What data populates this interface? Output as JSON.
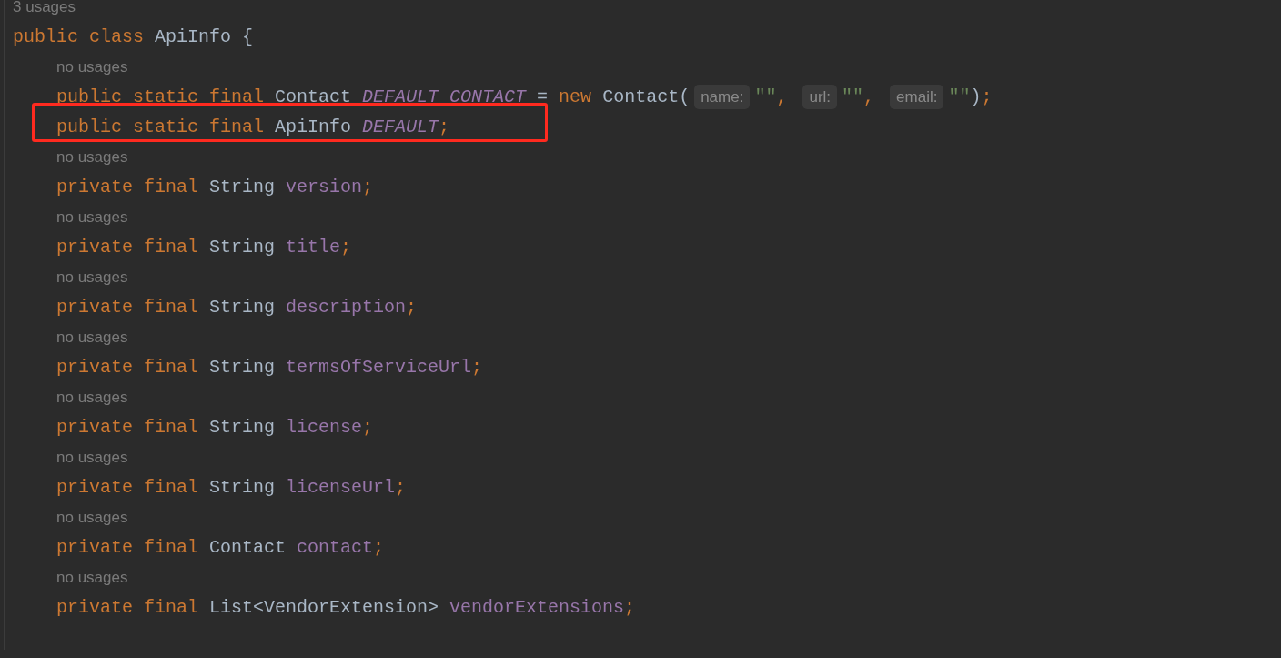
{
  "editor": {
    "lines": [
      {
        "kind": "usage",
        "text": "3 usages"
      },
      {
        "kind": "code",
        "tokens": [
          {
            "kind": "keyword",
            "text": "public class "
          },
          {
            "kind": "plain",
            "text": "ApiInfo {"
          }
        ],
        "children": [
          {
            "kind": "usage",
            "text": "no usages"
          },
          {
            "kind": "code",
            "tokens": [
              {
                "kind": "keyword",
                "text": "public static final "
              },
              {
                "kind": "plain",
                "text": "Contact "
              },
              {
                "kind": "constant",
                "text": "DEFAULT_CONTACT"
              },
              {
                "kind": "plain",
                "text": " = "
              },
              {
                "kind": "keyword",
                "text": "new "
              },
              {
                "kind": "plain",
                "text": "Contact("
              },
              {
                "kind": "hint",
                "text": "name:"
              },
              {
                "kind": "string",
                "text": "\"\""
              },
              {
                "kind": "punct",
                "text": ", "
              },
              {
                "kind": "hint",
                "text": "url:"
              },
              {
                "kind": "string",
                "text": "\"\""
              },
              {
                "kind": "punct",
                "text": ", "
              },
              {
                "kind": "hint",
                "text": "email:"
              },
              {
                "kind": "string",
                "text": "\"\""
              },
              {
                "kind": "plain",
                "text": ")"
              },
              {
                "kind": "punct",
                "text": ";"
              }
            ]
          },
          {
            "kind": "code",
            "tokens": [
              {
                "kind": "keyword",
                "text": "public static final "
              },
              {
                "kind": "plain",
                "text": "ApiInfo "
              },
              {
                "kind": "constant",
                "text": "DEFAULT"
              },
              {
                "kind": "punct",
                "text": ";"
              }
            ]
          },
          {
            "kind": "usage",
            "text": "no usages"
          },
          {
            "kind": "code",
            "tokens": [
              {
                "kind": "keyword",
                "text": "private final "
              },
              {
                "kind": "plain",
                "text": "String "
              },
              {
                "kind": "field",
                "text": "version"
              },
              {
                "kind": "punct",
                "text": ";"
              }
            ]
          },
          {
            "kind": "usage",
            "text": "no usages"
          },
          {
            "kind": "code",
            "tokens": [
              {
                "kind": "keyword",
                "text": "private final "
              },
              {
                "kind": "plain",
                "text": "String "
              },
              {
                "kind": "field",
                "text": "title"
              },
              {
                "kind": "punct",
                "text": ";"
              }
            ]
          },
          {
            "kind": "usage",
            "text": "no usages"
          },
          {
            "kind": "code",
            "tokens": [
              {
                "kind": "keyword",
                "text": "private final "
              },
              {
                "kind": "plain",
                "text": "String "
              },
              {
                "kind": "field",
                "text": "description"
              },
              {
                "kind": "punct",
                "text": ";"
              }
            ]
          },
          {
            "kind": "usage",
            "text": "no usages"
          },
          {
            "kind": "code",
            "tokens": [
              {
                "kind": "keyword",
                "text": "private final "
              },
              {
                "kind": "plain",
                "text": "String "
              },
              {
                "kind": "field",
                "text": "termsOfServiceUrl"
              },
              {
                "kind": "punct",
                "text": ";"
              }
            ]
          },
          {
            "kind": "usage",
            "text": "no usages"
          },
          {
            "kind": "code",
            "tokens": [
              {
                "kind": "keyword",
                "text": "private final "
              },
              {
                "kind": "plain",
                "text": "String "
              },
              {
                "kind": "field",
                "text": "license"
              },
              {
                "kind": "punct",
                "text": ";"
              }
            ]
          },
          {
            "kind": "usage",
            "text": "no usages"
          },
          {
            "kind": "code",
            "tokens": [
              {
                "kind": "keyword",
                "text": "private final "
              },
              {
                "kind": "plain",
                "text": "String "
              },
              {
                "kind": "field",
                "text": "licenseUrl"
              },
              {
                "kind": "punct",
                "text": ";"
              }
            ]
          },
          {
            "kind": "usage",
            "text": "no usages"
          },
          {
            "kind": "code",
            "tokens": [
              {
                "kind": "keyword",
                "text": "private final "
              },
              {
                "kind": "plain",
                "text": "Contact "
              },
              {
                "kind": "field",
                "text": "contact"
              },
              {
                "kind": "punct",
                "text": ";"
              }
            ]
          },
          {
            "kind": "usage",
            "text": "no usages"
          },
          {
            "kind": "code",
            "tokens": [
              {
                "kind": "keyword",
                "text": "private final "
              },
              {
                "kind": "plain",
                "text": "List<VendorExtension> "
              },
              {
                "kind": "field",
                "text": "vendorExtensions"
              },
              {
                "kind": "punct",
                "text": ";"
              }
            ]
          }
        ]
      }
    ]
  },
  "annotation_frame": true
}
